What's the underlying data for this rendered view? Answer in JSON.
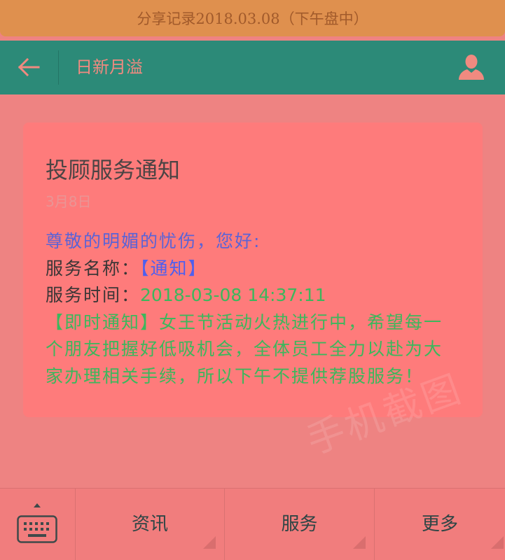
{
  "share_banner": {
    "text": "分享记录2018.03.08（下午盘中）"
  },
  "header": {
    "back_icon": "arrow-left-icon",
    "title": "日新月溢",
    "profile_icon": "user-icon"
  },
  "notice_card": {
    "title": "投顾服务通知",
    "date": "3月8日",
    "greeting": "尊敬的明媚的忧伤，您好:",
    "service_name": {
      "label": "服务名称：",
      "value": "【通知】"
    },
    "service_time": {
      "label": "服务时间：",
      "value": "2018-03-08 14:37:11"
    },
    "message_lines": [
      "【即时通知】女王节活动火热进行中，希望每一",
      "个朋友把握好低吸机会，全体员工全力以赴为大",
      "家办理相关手续，所以下午不提供荐股服务！"
    ]
  },
  "watermark": "手机截图",
  "bottom_menu": {
    "keyboard_icon": "keyboard-icon",
    "expand_icon": "triangle-up-icon",
    "tabs": [
      {
        "label": "资讯",
        "indicator_icon": "submenu-corner-icon"
      },
      {
        "label": "服务",
        "indicator_icon": "submenu-corner-icon"
      },
      {
        "label": "更多",
        "indicator_icon": "submenu-corner-icon"
      }
    ]
  },
  "colors": {
    "page_bg": "#EE8382",
    "banner_bg": "#DF904E",
    "banner_text": "#A15A2B",
    "header_bg": "#2C8A78",
    "header_fg": "#F08A80",
    "card_bg": "#FE7B7B",
    "title_text": "#4C4444",
    "date_text": "#E99595",
    "greeting_text": "#5B63D6",
    "label_text": "#3A3636",
    "highlight_blue": "#4E5FEF",
    "message_green": "#3CB75C",
    "menu_bg": "#F17D7D",
    "menu_text": "#2D4545"
  }
}
